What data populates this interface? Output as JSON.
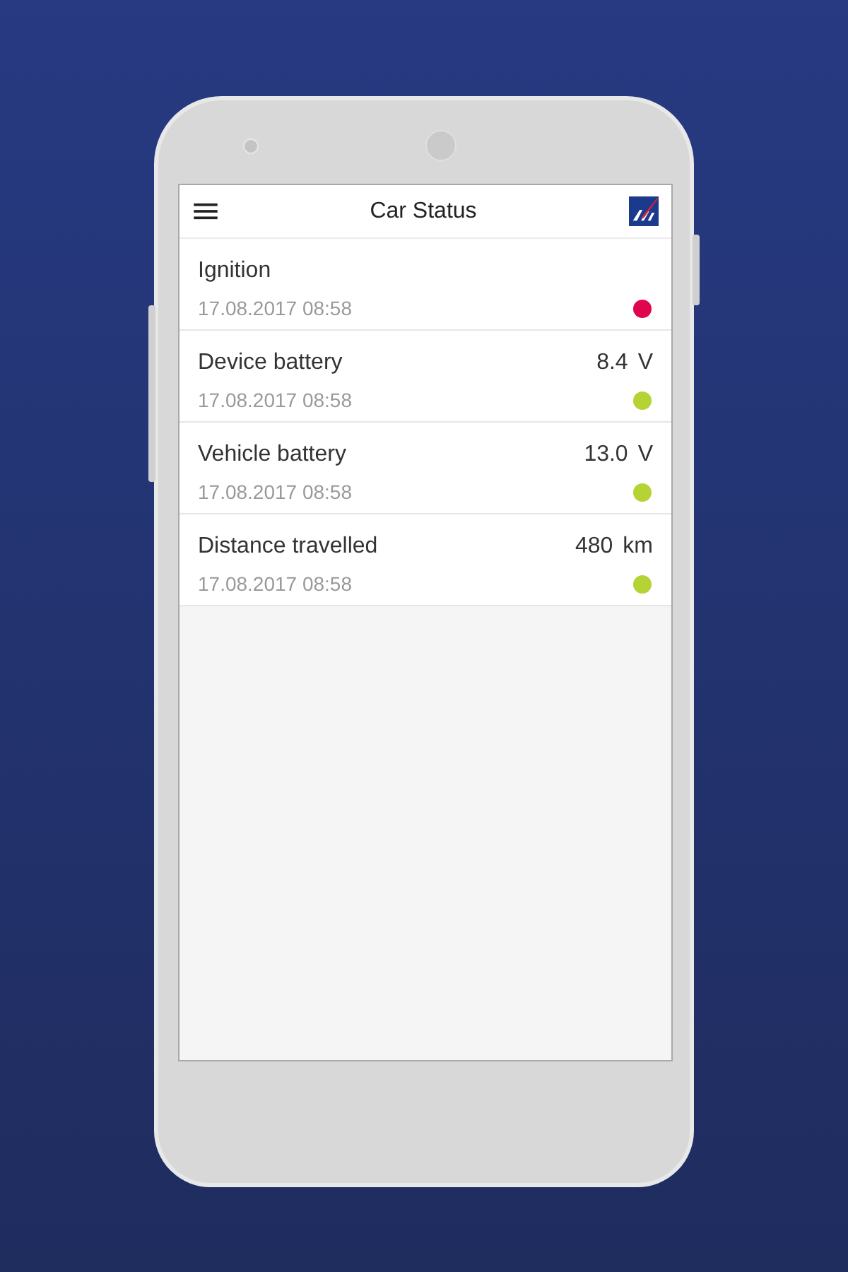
{
  "app_bar": {
    "title": "Car Status"
  },
  "items": [
    {
      "label": "Ignition",
      "timestamp": "17.08.2017 08:58",
      "color": "#e0064e"
    },
    {
      "label": "Device battery",
      "value": "8.4",
      "unit": "V",
      "timestamp": "17.08.2017 08:58",
      "color": "#b5d334"
    },
    {
      "label": "Vehicle battery",
      "value": "13.0",
      "unit": "V",
      "timestamp": "17.08.2017 08:58",
      "color": "#b5d334"
    },
    {
      "label": "Distance travelled",
      "value": "480",
      "unit": "km",
      "timestamp": "17.08.2017 08:58",
      "color": "#b5d334"
    }
  ]
}
